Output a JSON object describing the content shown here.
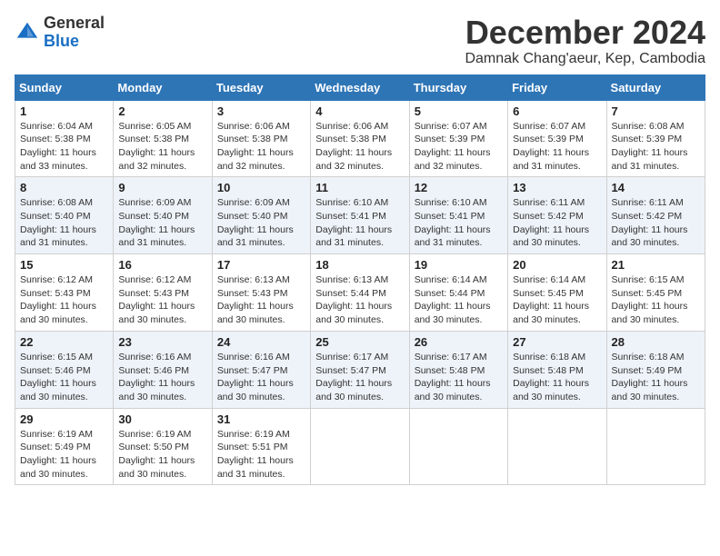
{
  "header": {
    "logo_general": "General",
    "logo_blue": "Blue",
    "month_title": "December 2024",
    "subtitle": "Damnak Chang'aeur, Kep, Cambodia"
  },
  "calendar": {
    "days_of_week": [
      "Sunday",
      "Monday",
      "Tuesday",
      "Wednesday",
      "Thursday",
      "Friday",
      "Saturday"
    ],
    "weeks": [
      [
        {
          "day": "1",
          "sunrise": "6:04 AM",
          "sunset": "5:38 PM",
          "daylight": "11 hours and 33 minutes."
        },
        {
          "day": "2",
          "sunrise": "6:05 AM",
          "sunset": "5:38 PM",
          "daylight": "11 hours and 32 minutes."
        },
        {
          "day": "3",
          "sunrise": "6:06 AM",
          "sunset": "5:38 PM",
          "daylight": "11 hours and 32 minutes."
        },
        {
          "day": "4",
          "sunrise": "6:06 AM",
          "sunset": "5:38 PM",
          "daylight": "11 hours and 32 minutes."
        },
        {
          "day": "5",
          "sunrise": "6:07 AM",
          "sunset": "5:39 PM",
          "daylight": "11 hours and 32 minutes."
        },
        {
          "day": "6",
          "sunrise": "6:07 AM",
          "sunset": "5:39 PM",
          "daylight": "11 hours and 31 minutes."
        },
        {
          "day": "7",
          "sunrise": "6:08 AM",
          "sunset": "5:39 PM",
          "daylight": "11 hours and 31 minutes."
        }
      ],
      [
        {
          "day": "8",
          "sunrise": "6:08 AM",
          "sunset": "5:40 PM",
          "daylight": "11 hours and 31 minutes."
        },
        {
          "day": "9",
          "sunrise": "6:09 AM",
          "sunset": "5:40 PM",
          "daylight": "11 hours and 31 minutes."
        },
        {
          "day": "10",
          "sunrise": "6:09 AM",
          "sunset": "5:40 PM",
          "daylight": "11 hours and 31 minutes."
        },
        {
          "day": "11",
          "sunrise": "6:10 AM",
          "sunset": "5:41 PM",
          "daylight": "11 hours and 31 minutes."
        },
        {
          "day": "12",
          "sunrise": "6:10 AM",
          "sunset": "5:41 PM",
          "daylight": "11 hours and 31 minutes."
        },
        {
          "day": "13",
          "sunrise": "6:11 AM",
          "sunset": "5:42 PM",
          "daylight": "11 hours and 30 minutes."
        },
        {
          "day": "14",
          "sunrise": "6:11 AM",
          "sunset": "5:42 PM",
          "daylight": "11 hours and 30 minutes."
        }
      ],
      [
        {
          "day": "15",
          "sunrise": "6:12 AM",
          "sunset": "5:43 PM",
          "daylight": "11 hours and 30 minutes."
        },
        {
          "day": "16",
          "sunrise": "6:12 AM",
          "sunset": "5:43 PM",
          "daylight": "11 hours and 30 minutes."
        },
        {
          "day": "17",
          "sunrise": "6:13 AM",
          "sunset": "5:43 PM",
          "daylight": "11 hours and 30 minutes."
        },
        {
          "day": "18",
          "sunrise": "6:13 AM",
          "sunset": "5:44 PM",
          "daylight": "11 hours and 30 minutes."
        },
        {
          "day": "19",
          "sunrise": "6:14 AM",
          "sunset": "5:44 PM",
          "daylight": "11 hours and 30 minutes."
        },
        {
          "day": "20",
          "sunrise": "6:14 AM",
          "sunset": "5:45 PM",
          "daylight": "11 hours and 30 minutes."
        },
        {
          "day": "21",
          "sunrise": "6:15 AM",
          "sunset": "5:45 PM",
          "daylight": "11 hours and 30 minutes."
        }
      ],
      [
        {
          "day": "22",
          "sunrise": "6:15 AM",
          "sunset": "5:46 PM",
          "daylight": "11 hours and 30 minutes."
        },
        {
          "day": "23",
          "sunrise": "6:16 AM",
          "sunset": "5:46 PM",
          "daylight": "11 hours and 30 minutes."
        },
        {
          "day": "24",
          "sunrise": "6:16 AM",
          "sunset": "5:47 PM",
          "daylight": "11 hours and 30 minutes."
        },
        {
          "day": "25",
          "sunrise": "6:17 AM",
          "sunset": "5:47 PM",
          "daylight": "11 hours and 30 minutes."
        },
        {
          "day": "26",
          "sunrise": "6:17 AM",
          "sunset": "5:48 PM",
          "daylight": "11 hours and 30 minutes."
        },
        {
          "day": "27",
          "sunrise": "6:18 AM",
          "sunset": "5:48 PM",
          "daylight": "11 hours and 30 minutes."
        },
        {
          "day": "28",
          "sunrise": "6:18 AM",
          "sunset": "5:49 PM",
          "daylight": "11 hours and 30 minutes."
        }
      ],
      [
        {
          "day": "29",
          "sunrise": "6:19 AM",
          "sunset": "5:49 PM",
          "daylight": "11 hours and 30 minutes."
        },
        {
          "day": "30",
          "sunrise": "6:19 AM",
          "sunset": "5:50 PM",
          "daylight": "11 hours and 30 minutes."
        },
        {
          "day": "31",
          "sunrise": "6:19 AM",
          "sunset": "5:51 PM",
          "daylight": "11 hours and 31 minutes."
        },
        null,
        null,
        null,
        null
      ]
    ],
    "labels": {
      "sunrise": "Sunrise:",
      "sunset": "Sunset:",
      "daylight": "Daylight:"
    }
  }
}
